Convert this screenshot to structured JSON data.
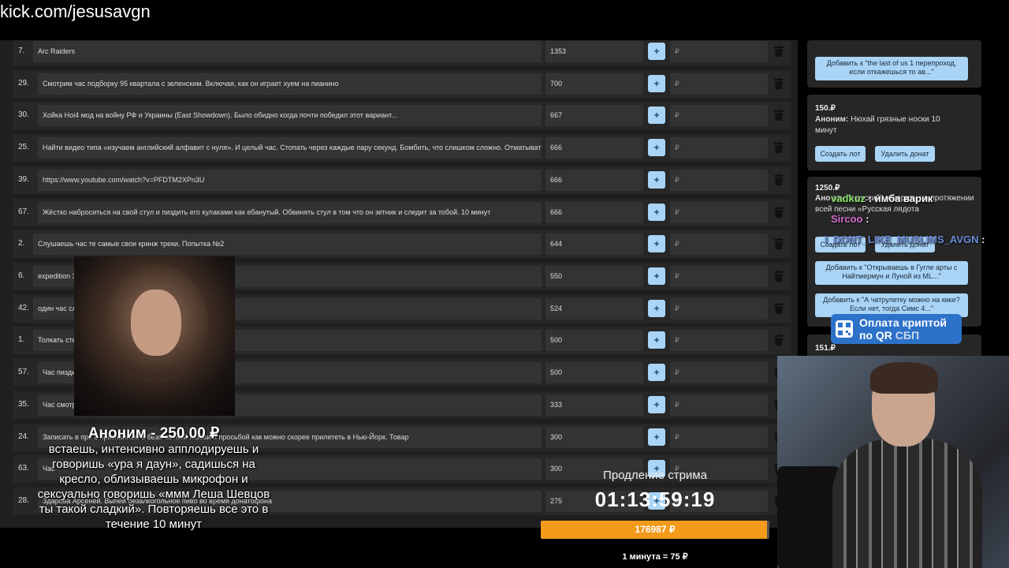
{
  "url": "kick.com/jesusavgn",
  "lots": [
    {
      "num": "7.",
      "title": "Arc Raiders",
      "amount": "1353",
      "rub": "₽"
    },
    {
      "num": "29.",
      "title": "Смотрим час подборку 95 квартала с зеленским. Включая, как он играет хуем на пианино",
      "amount": "700",
      "rub": "₽"
    },
    {
      "num": "30.",
      "title": "Хойка Hoi4 мод на войну РФ и Украины (East Showdown). Было обидно когда почти победил этот вариант...",
      "amount": "667",
      "rub": "₽"
    },
    {
      "num": "25.",
      "title": "Найти видео типа «изучаем английский алфавит с нуля». И целый час. Стопать через каждые пару секунд. Бомбить, что слишком сложно. Отматывать",
      "amount": "666",
      "rub": "₽"
    },
    {
      "num": "39.",
      "title": "https://www.youtube.com/watch?v=PFDTM2XPn3U",
      "amount": "666",
      "rub": "₽"
    },
    {
      "num": "67.",
      "title": "Жёстко наброситься на свой стул и пиздить его кулаками как ебанутый. Обвинять стул в том что он зетник и следит за тобой. 10 минут",
      "amount": "666",
      "rub": "₽"
    },
    {
      "num": "2.",
      "title": "Слушаешь час те самые свои кринж треки. Попытка №2",
      "amount": "644",
      "rub": "₽"
    },
    {
      "num": "6.",
      "title": "expedition 33",
      "amount": "550",
      "rub": "₽"
    },
    {
      "num": "42.",
      "title": "один час сл",
      "amount": "524",
      "rub": "₽"
    },
    {
      "num": "1.",
      "title": "Толкать стен",
      "amount": "500",
      "rub": "₽"
    },
    {
      "num": "57.",
      "title": "Час пиздит",
      "amount": "500",
      "rub": "₽"
    },
    {
      "num": "35.",
      "title": "Час смотре                                                  ?si=FbjDByREX8xgMEeD",
      "amount": "333",
      "rub": "₽"
    },
    {
      "num": "24.",
      "title": "Записать в про                                          с признанием в безответной любви и просьбой как можно скорее прилететь в Нью-Йорк. Товар",
      "amount": "300",
      "rub": "₽"
    },
    {
      "num": "63.",
      "title": "Час ",
      "amount": "300",
      "rub": "₽"
    },
    {
      "num": "28.",
      "title": "Здарова Арсеней. Выпей безалкогольное пиво во время донатофона",
      "amount": "275",
      "rub": "₽"
    }
  ],
  "sidebar": {
    "card1_btn": "Добавить к \"the last of us 1 перепроход, если откажешься то ав...\"",
    "card2": {
      "price": "150.₽",
      "author": "Аноним:",
      "text": "Нюхай грязные носки 10 минут",
      "create_lot": "Создать лот",
      "delete": "Удалить донат"
    },
    "card3": {
      "price": "1250.₽",
      "author": "Ано",
      "text": "ать \"я руский\" говорить на протяжении всей песни «Русская лядота",
      "create_lot": "Создать лот",
      "delete": "Удалить донат",
      "btn1": "Добавить к \"Открываешь в Гугле арты с Найтмермун и Луной из ML...\"",
      "btn2": "Добавить к \"А чатрулетку можно на кике? Если нет, тогда Симс 4...\""
    },
    "card4_price": "151.₽"
  },
  "chat": [
    {
      "user": "vadkuz",
      "message": ": имба варик",
      "color": "#8be36b"
    },
    {
      "user": "Sircoo",
      "message": ":",
      "color": "#d46bd0"
    },
    {
      "user": "I_DONT_LIKE_MUSLIMS_AVGN",
      "message": ":",
      "color": "#6b8bd8"
    }
  ],
  "qr": {
    "line1": "Оплата криптой",
    "line2": "по QR",
    "sbp": "СБП"
  },
  "alert": {
    "name": "Аноним - 250.00 ₽",
    "message": "встаешь, интенсивно апплодируешь и говоришь «ура я даун», садишься на кресло, облизываешь микрофон и сексуально говоришь «ммм Леша Шевцов ты такой сладкий». Повторяешь все это в течение 10 минут"
  },
  "timer": {
    "label": "Продление стрима",
    "value": "01:13:59:19",
    "total": "176987 ₽",
    "progress": 0.99,
    "rate": "1 минута = 75 ₽"
  },
  "colors": {
    "accent_button": "#a9d4f5",
    "progress": "#f39a1b"
  }
}
